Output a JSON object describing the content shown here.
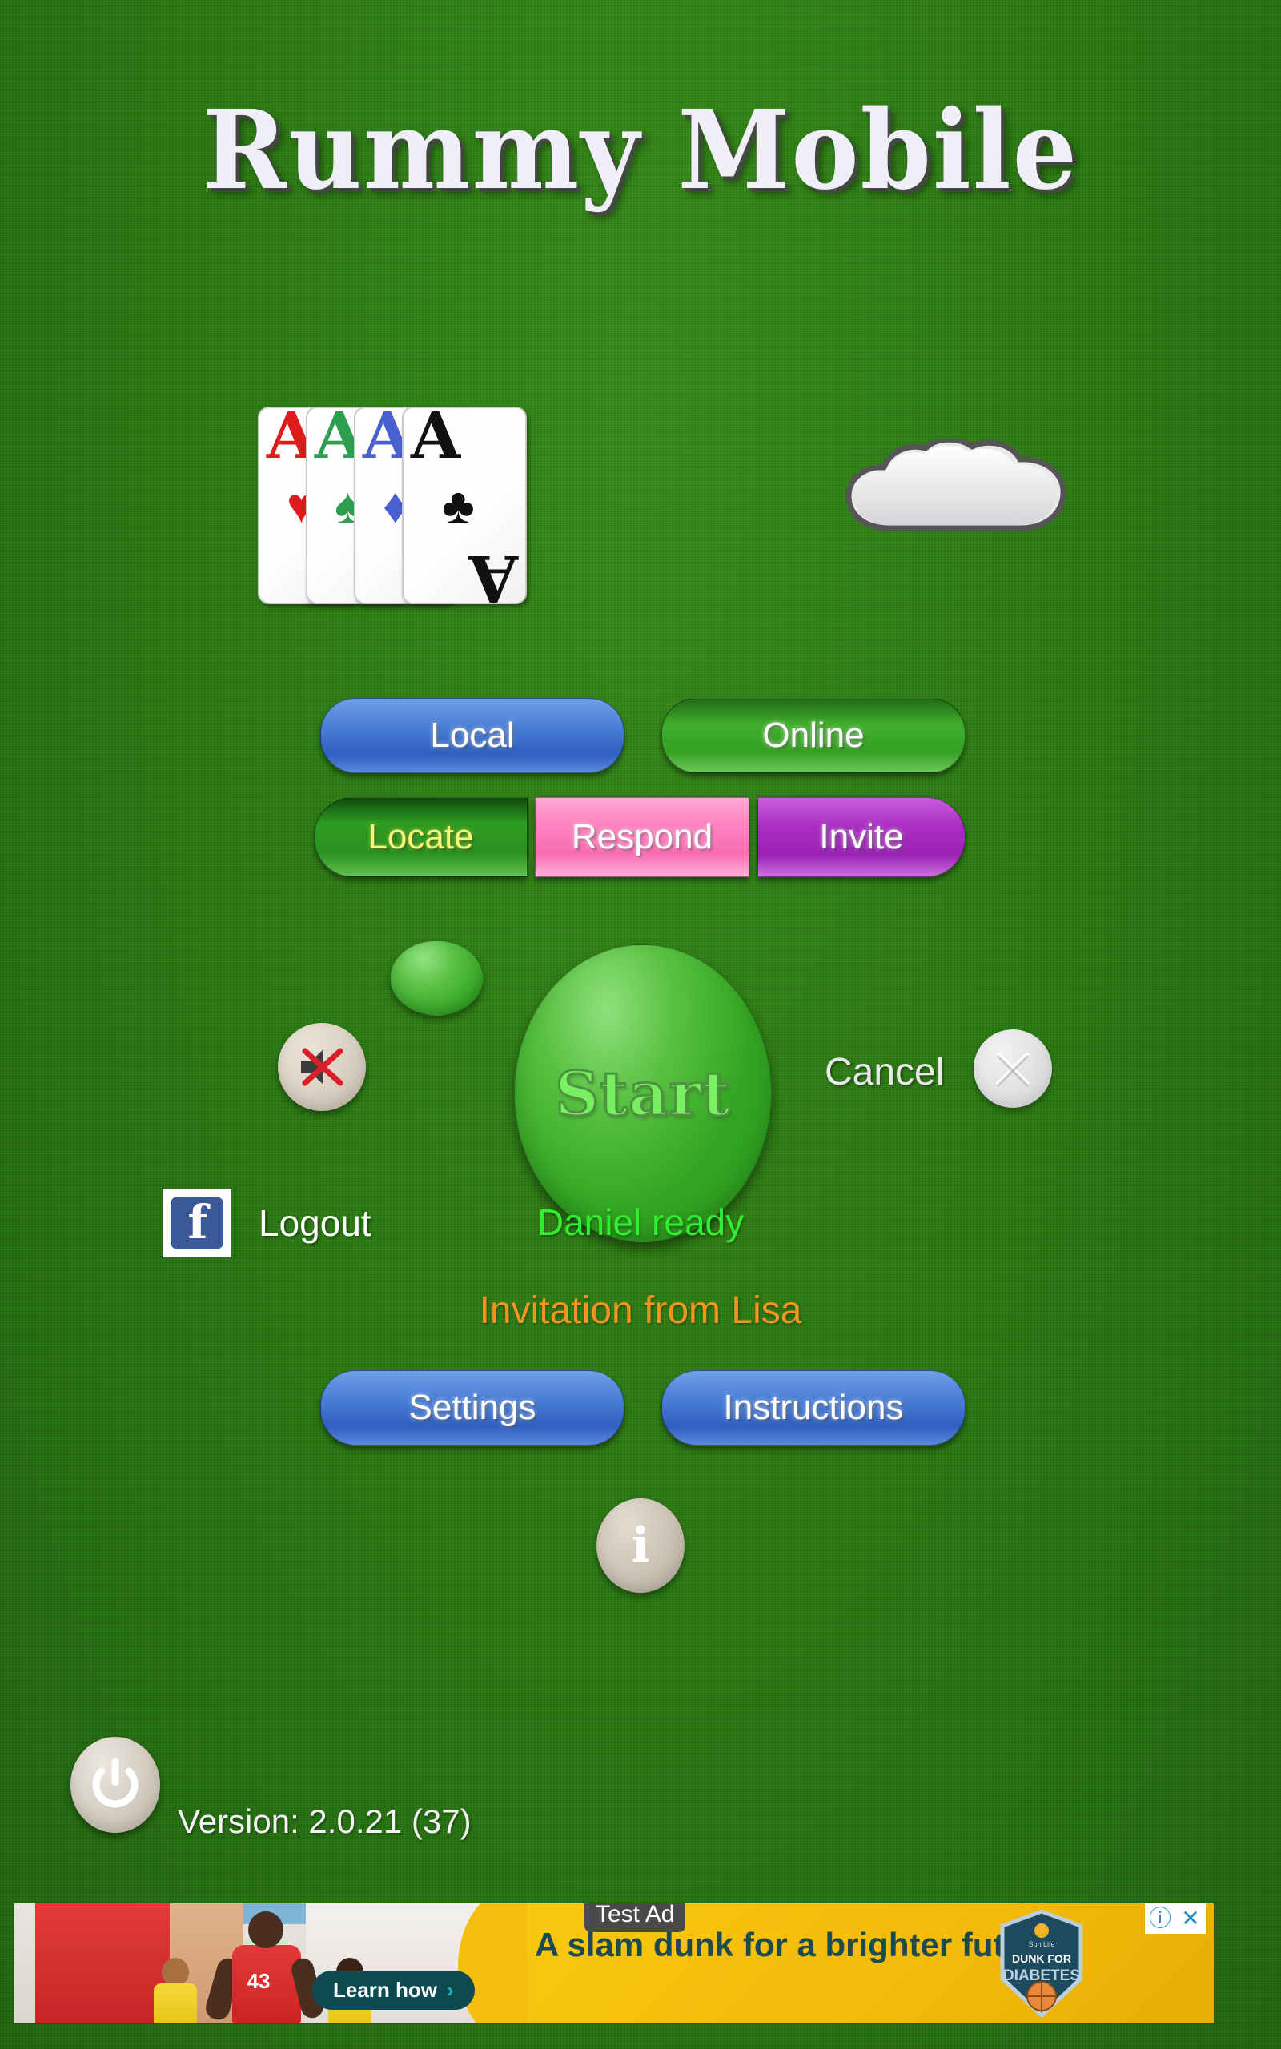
{
  "app": {
    "title": "Rummy Mobile",
    "version": "Version: 2.0.21 (37)"
  },
  "hero": {
    "cards": [
      {
        "rank": "A",
        "suit": "heart",
        "glyph": "♥",
        "color": "#e01b1b"
      },
      {
        "rank": "A",
        "suit": "spade",
        "glyph": "♠",
        "color": "#2e9e4f"
      },
      {
        "rank": "A",
        "suit": "diamond",
        "glyph": "♦",
        "color": "#4a5fd0"
      },
      {
        "rank": "A",
        "suit": "club",
        "glyph": "♣",
        "color": "#111111"
      }
    ],
    "cloud_icon": "cloud-icon"
  },
  "mode_buttons": [
    {
      "name": "local",
      "label": "Local",
      "color": "#3b6fd4"
    },
    {
      "name": "online",
      "label": "Online",
      "color": "#33a024"
    }
  ],
  "online_buttons": [
    {
      "name": "locate",
      "label": "Locate",
      "color": "#2f9c22",
      "text_color": "#f4f77a"
    },
    {
      "name": "respond",
      "label": "Respond",
      "color": "#f86cb2",
      "text_color": "#ffffff"
    },
    {
      "name": "invite",
      "label": "Invite",
      "color": "#9b21b4",
      "text_color": "#ffffff"
    }
  ],
  "start_area": {
    "start_label": "Start",
    "cancel_label": "Cancel",
    "cancel_icon": "close-x-icon",
    "mute_icon": "speaker-muted-icon",
    "ready_indicator_icon": "ready-dot-icon"
  },
  "account": {
    "facebook_icon": "facebook-icon",
    "logout_label": "Logout"
  },
  "status": {
    "ready": "Daniel ready",
    "ready_color": "#2ff02f",
    "invitation": "Invitation from Lisa",
    "invitation_color": "#f4941e"
  },
  "footer_buttons": [
    {
      "name": "settings",
      "label": "Settings",
      "color": "#3b6fd4"
    },
    {
      "name": "instructions",
      "label": "Instructions",
      "color": "#3b6fd4"
    }
  ],
  "info_button": {
    "icon": "info-icon",
    "glyph": "i"
  },
  "power_button": {
    "icon": "power-icon"
  },
  "ad": {
    "badge_label": "Test Ad",
    "headline": "A slam dunk for a brighter future.",
    "cta_label": "Learn how",
    "cta_chevron": "›",
    "logo_line1": "Sun Life",
    "logo_line2": "DUNK FOR",
    "logo_line3": "DIABETES",
    "jersey_number": "43",
    "info_icon": "ad-info-icon",
    "info_glyph": "ⓘ",
    "close_icon": "ad-close-icon",
    "close_glyph": "✕",
    "bg_color": "#f3bb0a",
    "text_color": "#1d4a4f"
  }
}
